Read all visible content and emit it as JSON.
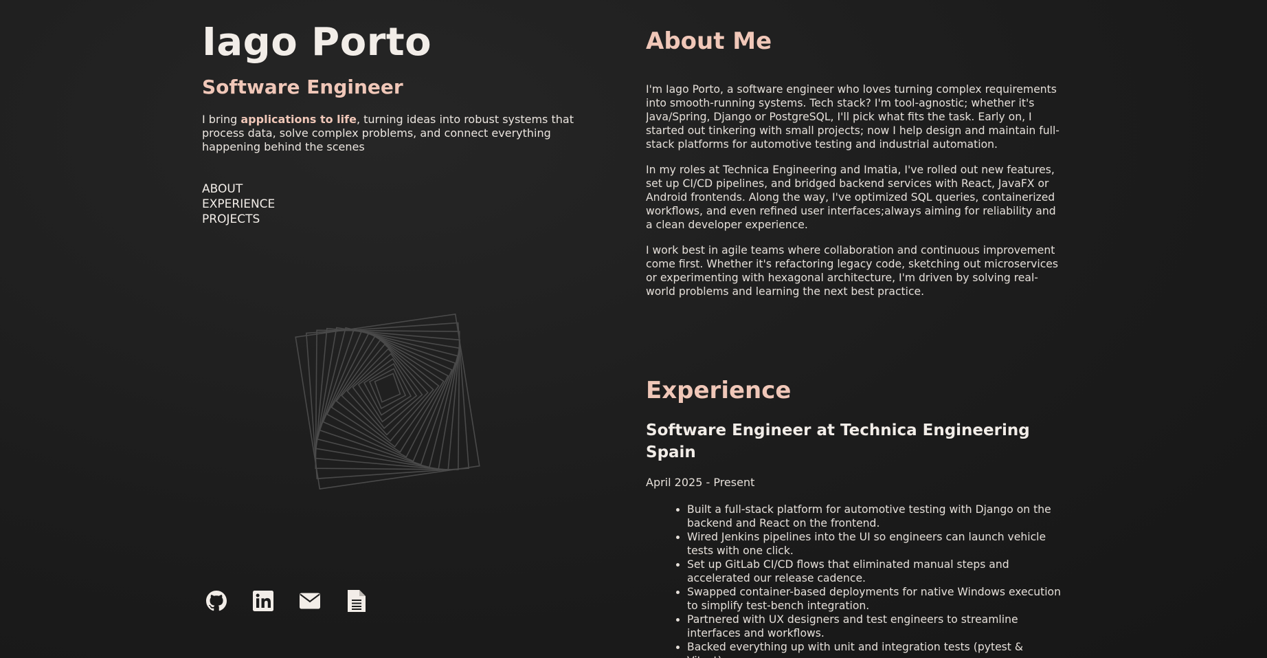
{
  "header": {
    "name": "Iago Porto",
    "role": "Software Engineer",
    "intro_prefix": "I bring ",
    "intro_highlight": "applications to life",
    "intro_suffix": ", turning ideas into robust systems that process data, solve complex problems, and connect everything happening behind the scenes"
  },
  "nav": {
    "items": [
      "ABOUT",
      "EXPERIENCE",
      "PROJECTS"
    ]
  },
  "socials": {
    "icons": [
      "github-icon",
      "linkedin-icon",
      "mail-icon",
      "document-icon"
    ]
  },
  "about": {
    "title": "About Me",
    "paragraphs": [
      "I'm Iago Porto, a software engineer who loves turning complex requirements into smooth-running systems. Tech stack? I'm tool-agnostic; whether it's Java/Spring, Django or PostgreSQL, I'll pick what fits the task. Early on, I started out tinkering with small projects; now I help design and maintain full-stack platforms for automotive testing and industrial automation.",
      "In my roles at Technica Engineering and Imatia, I've rolled out new features, set up CI/CD pipelines, and bridged backend services with React, JavaFX or Android frontends. Along the way, I've optimized SQL queries, containerized workflows, and even refined user interfaces;always aiming for reliability and a clean developer experience.",
      "I work best in agile teams where collaboration and continuous improvement come first. Whether it's refactoring legacy code, sketching out microservices or experimenting with hexagonal architecture, I'm driven by solving real-world problems and learning the next best practice."
    ]
  },
  "experience": {
    "title": "Experience",
    "jobs": [
      {
        "title": "Software Engineer at Technica Engineering Spain",
        "date": "April 2025 - Present",
        "bullets": [
          "Built a full-stack platform for automotive testing with Django on the backend and React on the frontend.",
          "Wired Jenkins pipelines into the UI so engineers can launch vehicle tests with one click.",
          "Set up GitLab CI/CD flows that eliminated manual steps and accelerated our release cadence.",
          "Swapped container-based deployments for native Windows execution to simplify test-bench integration.",
          "Partnered with UX designers and test engineers to streamline interfaces and workflows.",
          "Backed everything up with unit and integration tests (pytest & Vitest)."
        ]
      }
    ]
  },
  "colors": {
    "background": "#1b1b1b",
    "accent": "#f0c7b8",
    "text": "#e6e0da"
  }
}
